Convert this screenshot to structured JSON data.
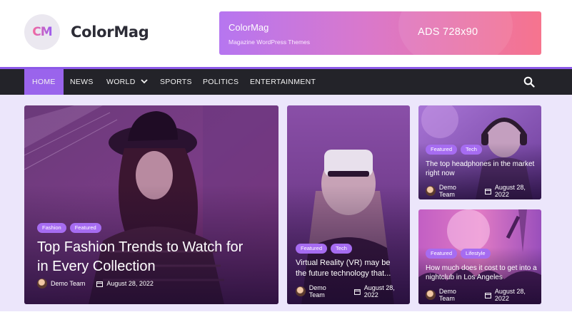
{
  "site": {
    "logo_text": "CM",
    "title": "ColorMag"
  },
  "ad": {
    "title": "ColorMag",
    "subtitle": "Magazine WordPress Themes",
    "size_text": "ADS 728x90"
  },
  "nav": {
    "items": [
      {
        "label": "HOME"
      },
      {
        "label": "NEWS"
      },
      {
        "label": "WORLD"
      },
      {
        "label": "SPORTS"
      },
      {
        "label": "POLITICS"
      },
      {
        "label": "ENTERTAINMENT"
      }
    ],
    "icons": {
      "dropdown": "chevron-down-icon",
      "search": "search-icon"
    }
  },
  "posts": [
    {
      "tags": [
        "Fashion",
        "Featured"
      ],
      "title": "Top Fashion Trends to Watch for in Every Collection",
      "author": "Demo Team",
      "date": "August 28, 2022"
    },
    {
      "tags": [
        "Featured",
        "Tech"
      ],
      "title": "Virtual Reality (VR) may be the future technology that...",
      "author": "Demo Team",
      "date": "August 28, 2022"
    },
    {
      "tags": [
        "Featured",
        "Tech"
      ],
      "title": "The top headphones in the market right now",
      "author": "Demo Team",
      "date": "August 28, 2022"
    },
    {
      "tags": [
        "Featured",
        "Lifestyle"
      ],
      "title": "How much does it cost to get into a nightclub in Los Angeles",
      "author": "Demo Team",
      "date": "August 28, 2022"
    }
  ],
  "colors": {
    "accent": "#9a64ec",
    "nav_bg": "#232329",
    "page_bg": "#ece6fb",
    "tag_bg": "#a66cf1"
  }
}
